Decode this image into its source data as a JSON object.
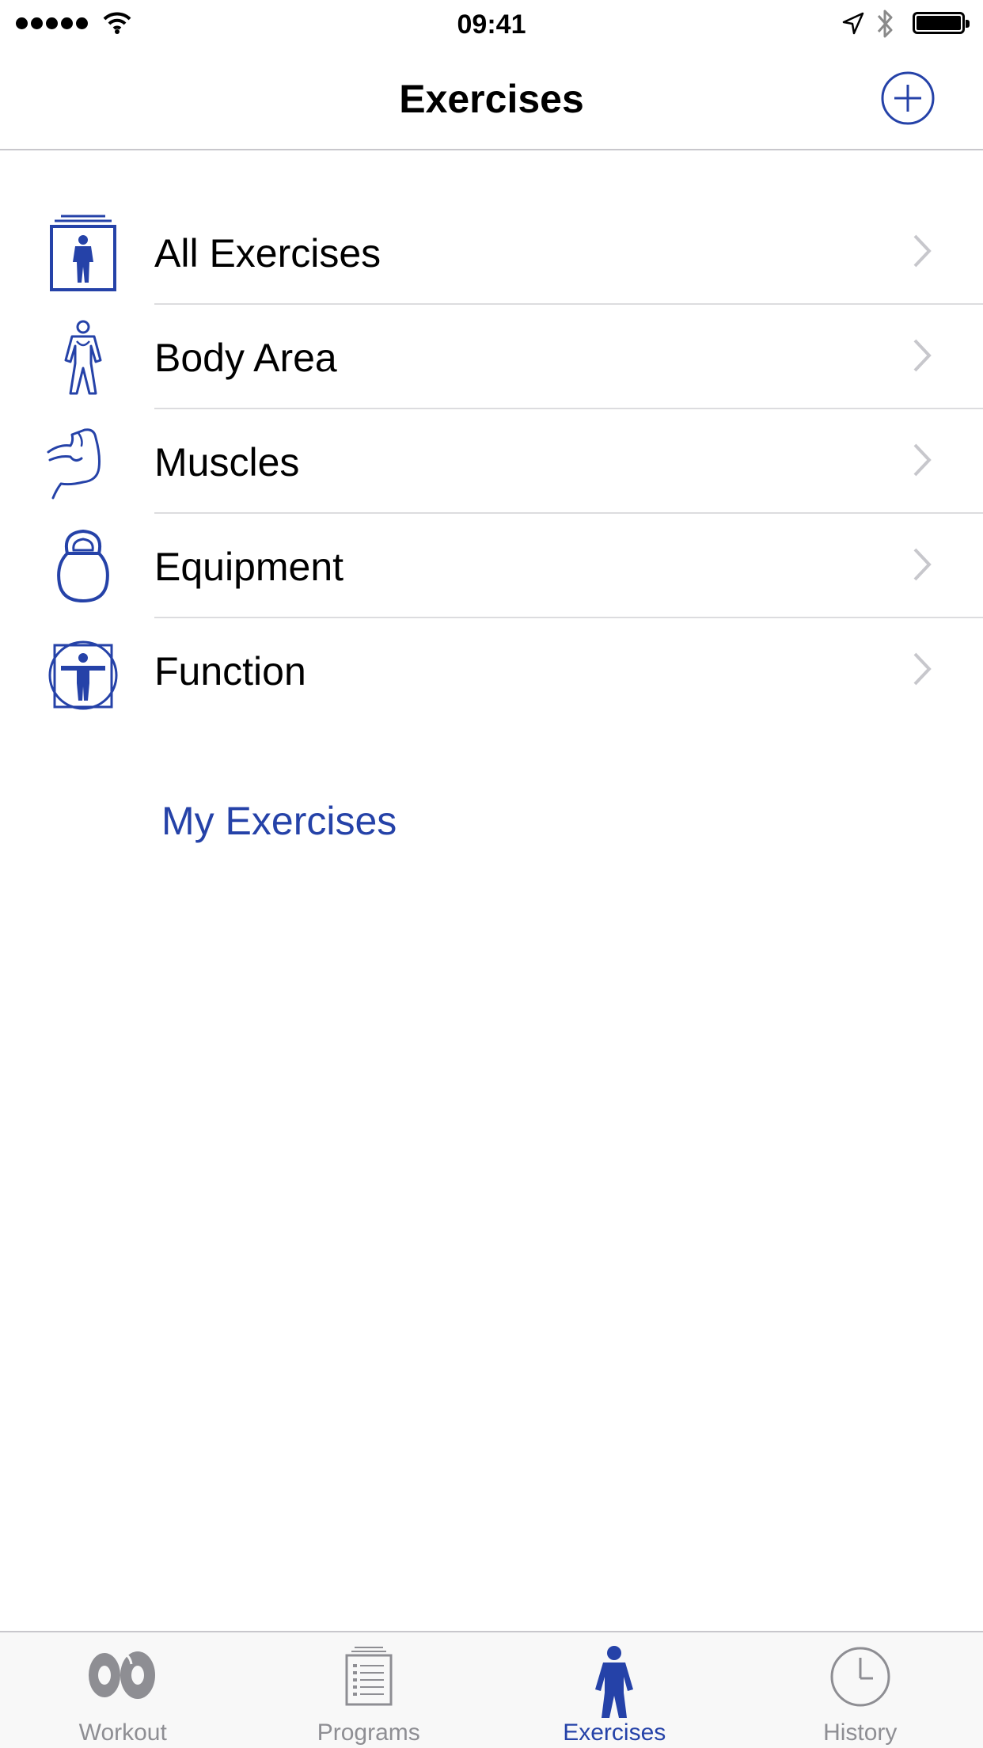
{
  "status_bar": {
    "time": "09:41",
    "signal_icon": "signal-dots-icon",
    "wifi_icon": "wifi-icon",
    "location_icon": "location-arrow-icon",
    "bluetooth_icon": "bluetooth-icon",
    "battery_icon": "battery-icon",
    "battery_level": 1.0
  },
  "nav": {
    "title": "Exercises",
    "add_icon": "plus-circle-icon"
  },
  "list": {
    "items": [
      {
        "label": "All Exercises",
        "icon": "all-exercises-icon"
      },
      {
        "label": "Body Area",
        "icon": "body-area-icon"
      },
      {
        "label": "Muscles",
        "icon": "muscle-icon"
      },
      {
        "label": "Equipment",
        "icon": "kettlebell-icon"
      },
      {
        "label": "Function",
        "icon": "function-icon"
      }
    ]
  },
  "my_exercises_label": "My Exercises",
  "tabs": [
    {
      "label": "Workout",
      "icon": "weights-icon",
      "active": false
    },
    {
      "label": "Programs",
      "icon": "clipboard-list-icon",
      "active": false
    },
    {
      "label": "Exercises",
      "icon": "person-icon",
      "active": true
    },
    {
      "label": "History",
      "icon": "clock-icon",
      "active": false
    }
  ],
  "colors": {
    "accent": "#2542a8",
    "inactive_tab": "#8e8e93",
    "chevron": "#c7c7cc",
    "separator": "#dcdcdf"
  }
}
